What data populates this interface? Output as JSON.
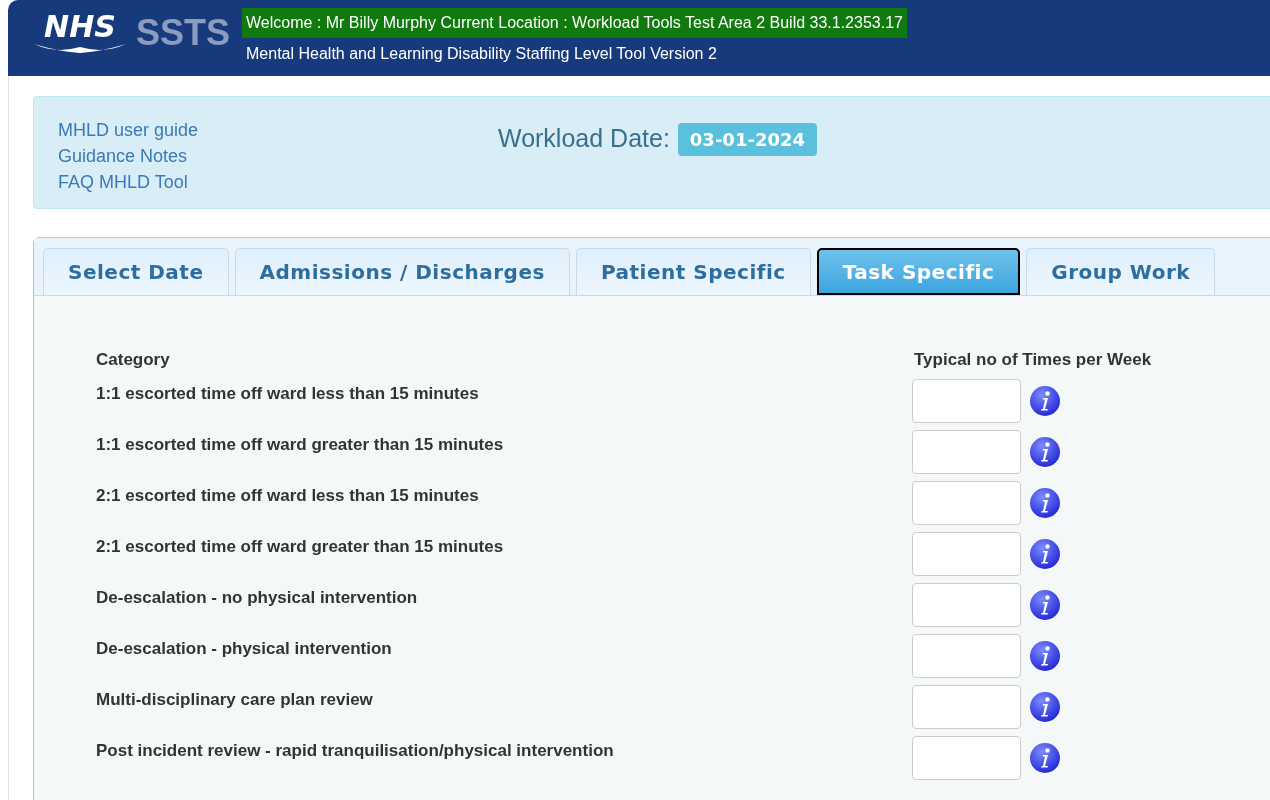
{
  "header": {
    "logo": "NHS",
    "product": "SSTS",
    "welcome": "Welcome : Mr Billy Murphy Current Location : Workload Tools Test Area 2 Build 33.1.2353.17",
    "subtitle": "Mental Health and Learning Disability Staffing Level Tool Version 2"
  },
  "links": [
    "MHLD user guide",
    "Guidance Notes",
    "FAQ MHLD Tool"
  ],
  "workload_date": {
    "label": "Workload Date:",
    "value": "03-01-2024"
  },
  "tabs": [
    {
      "label": "Select Date",
      "selected": false
    },
    {
      "label": "Admissions / Discharges",
      "selected": false
    },
    {
      "label": "Patient Specific",
      "selected": false
    },
    {
      "label": "Task Specific",
      "selected": true
    },
    {
      "label": "Group Work",
      "selected": false
    }
  ],
  "table": {
    "columns": [
      "Category",
      "Typical no of Times per Week"
    ],
    "rows": [
      {
        "category": "1:1 escorted time off ward less than 15 minutes"
      },
      {
        "category": "1:1 escorted time off ward greater than 15 minutes"
      },
      {
        "category": "2:1 escorted time off ward less than 15 minutes"
      },
      {
        "category": "2:1 escorted time off ward greater than 15 minutes"
      },
      {
        "category": "De-escalation - no physical intervention"
      },
      {
        "category": "De-escalation - physical intervention"
      },
      {
        "category": "Multi-disciplinary care plan review"
      },
      {
        "category": "Post incident review - rapid tranquilisation/physical intervention"
      }
    ]
  }
}
